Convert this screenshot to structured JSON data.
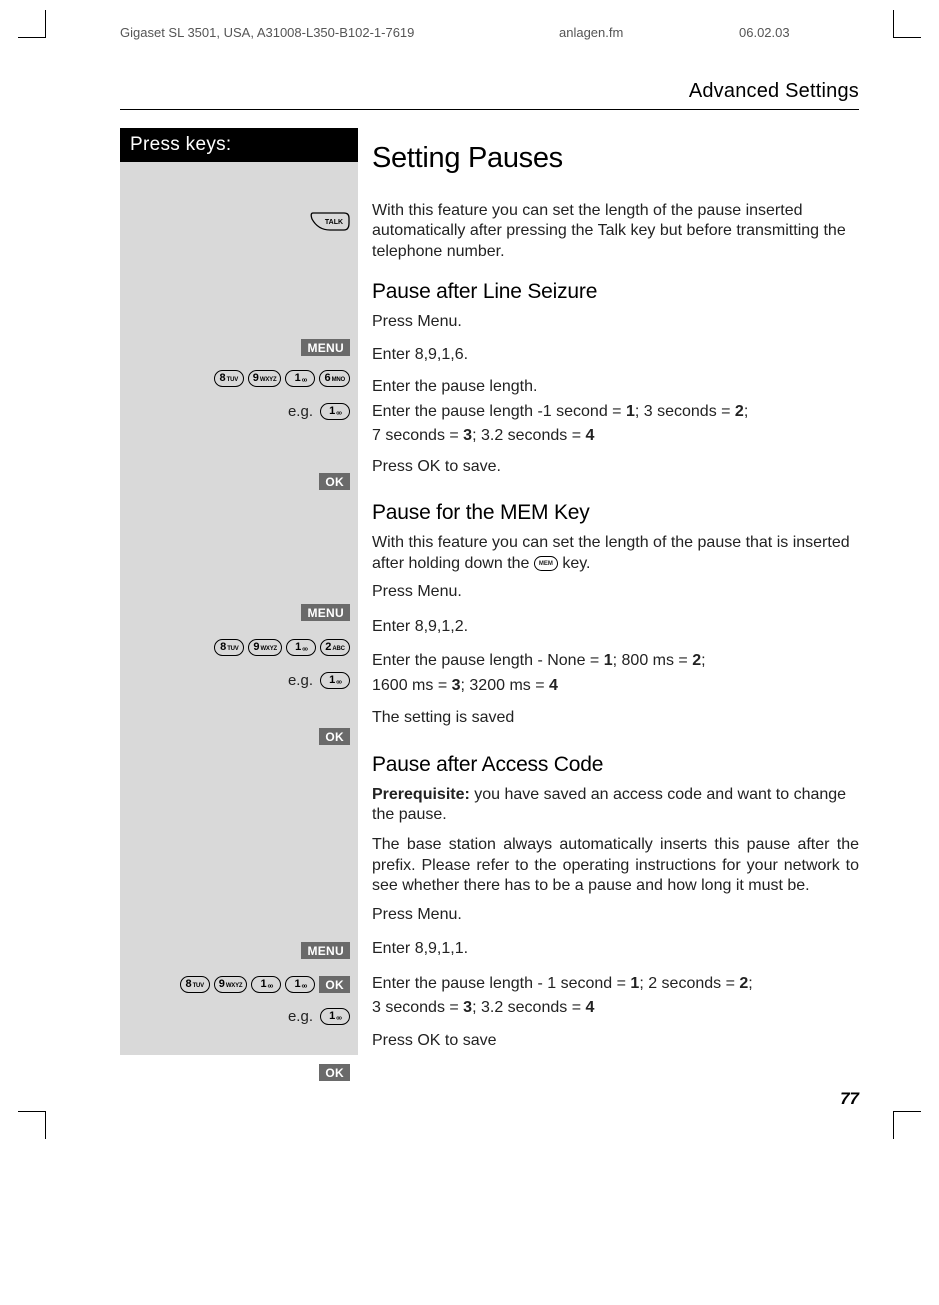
{
  "header": {
    "left": "Gigaset SL 3501, USA, A31008-L350-B102-1-7619",
    "mid": "anlagen.fm",
    "right": "06.02.03"
  },
  "sectionTitle": "Advanced Settings",
  "pressKeys": "Press keys:",
  "mainTitle": "Setting Pauses",
  "intro": "With this feature you can set the length of the pause inserted automatically after pressing the Talk key but before transmitting the telephone number.",
  "sub1": {
    "title": "Pause after Line Seizure",
    "menu": "Press Menu.",
    "enter": "Enter 8,9,1,6.",
    "egLabel": "e.g.",
    "pauseA": "Enter the pause length.",
    "pauseB_pre": "Enter the pause length -1 second = ",
    "b1": "1",
    "mid1": "; 3 seconds = ",
    "b2": "2",
    "mid2": ";",
    "lineC_pre": "7 seconds = ",
    "b3": "3",
    "mid3": "; 3.2 seconds = ",
    "b4": "4",
    "ok": "Press OK to save."
  },
  "sub2": {
    "title": "Pause for the MEM Key",
    "intro_pre": "With this feature you can set the length of the pause that is inserted after holding down the ",
    "intro_post": " key.",
    "menu": "Press Menu.",
    "enter": "Enter 8,9,1,2.",
    "egLabel": "e.g.",
    "pauseA_pre": "Enter the pause length - None = ",
    "a1": "1",
    "amid1": "; 800 ms = ",
    "a2": "2",
    "amid2": ";",
    "pauseB_pre": "1600 ms = ",
    "b1": "3",
    "bmid1": "; 3200 ms = ",
    "b2": "4",
    "ok": "The setting is saved"
  },
  "sub3": {
    "title": "Pause after Access Code",
    "prereqLabel": "Prerequisite:",
    "prereqText": " you have saved an access code and want to change the pause.",
    "body": "The base station always automatically inserts this pause after the prefix. Please refer to the operating instructions for your network to see whether there has to be a pause and how long it must be.",
    "menu": "Press Menu.",
    "enter": "Enter 8,9,1,1.",
    "egLabel": "e.g.",
    "pauseA_pre": "Enter the pause length - 1 second = ",
    "a1": "1",
    "amid1": "; 2 seconds = ",
    "a2": "2",
    "amid2": ";",
    "pauseB_pre": "3 seconds = ",
    "b1": "3",
    "bmid1": "; 3.2 seconds = ",
    "b2": "4",
    "ok": "Press OK to save"
  },
  "soft": {
    "menu": "MENU",
    "ok": "OK"
  },
  "keys": {
    "k8b": "8",
    "k8s": "TUV",
    "k9b": "9",
    "k9s": "WXYZ",
    "k1b": "1",
    "k1s": "┘┘",
    "k6b": "6",
    "k6s": "MNO",
    "k2b": "2",
    "k2s": "ABC",
    "mem": "MEM",
    "talk": "TALK"
  },
  "pageNum": "77"
}
